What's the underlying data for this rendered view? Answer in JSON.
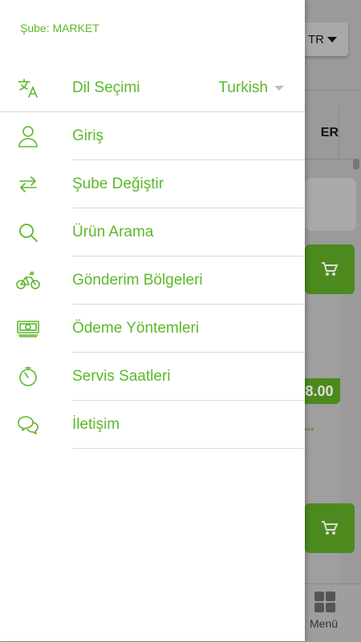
{
  "background": {
    "lang_button": "TR",
    "tab_fragment": "ER",
    "price_fragment": "8.00",
    "dots": "...",
    "bottom_menu_label": "Menü"
  },
  "drawer": {
    "branch_text": "Şube: MARKET",
    "language": {
      "label": "Dil Seçimi",
      "value": "Turkish",
      "icon": "translate-icon"
    },
    "items": [
      {
        "label": "Giriş",
        "icon": "user-icon"
      },
      {
        "label": "Şube Değiştir",
        "icon": "swap-arrows-icon"
      },
      {
        "label": "Ürün Arama",
        "icon": "search-icon"
      },
      {
        "label": "Gönderim Bölgeleri",
        "icon": "bicycle-icon"
      },
      {
        "label": "Ödeme Yöntemleri",
        "icon": "money-icon"
      },
      {
        "label": "Servis Saatleri",
        "icon": "stopwatch-icon"
      },
      {
        "label": "İletişim",
        "icon": "chat-icon"
      }
    ]
  },
  "colors": {
    "accent": "#5cb82a",
    "separator": "#d9d9d9",
    "cart_green": "#4c8a1e"
  }
}
